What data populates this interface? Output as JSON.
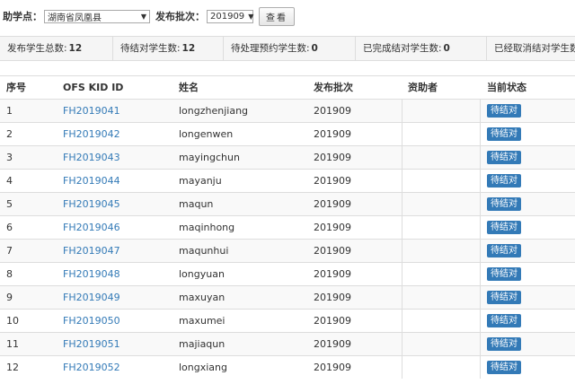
{
  "filters": {
    "county_label": "助学点：",
    "county_value": "湖南省凤凰县",
    "batch_label": "发布批次：",
    "batch_value": "201909",
    "view_button": "查看"
  },
  "stats": {
    "total_label": "发布学生总数:",
    "total_value": "12",
    "waiting_label": "待结对学生数:",
    "waiting_value": "12",
    "pending_label": "待处理预约学生数:",
    "pending_value": "0",
    "done_label": "已完成结对学生数:",
    "done_value": "0",
    "cancel_label": "已经取消结对学生数"
  },
  "table": {
    "headers": {
      "idx": "序号",
      "kid": "OFS KID ID",
      "name": "姓名",
      "batch": "发布批次",
      "sponsor": "资助者",
      "status": "当前状态"
    },
    "rows": [
      {
        "idx": "1",
        "kid": "FH2019041",
        "name": "longzhenjiang",
        "batch": "201909",
        "sponsor": "",
        "status": "待结对"
      },
      {
        "idx": "2",
        "kid": "FH2019042",
        "name": "longenwen",
        "batch": "201909",
        "sponsor": "",
        "status": "待结对"
      },
      {
        "idx": "3",
        "kid": "FH2019043",
        "name": "mayingchun",
        "batch": "201909",
        "sponsor": "",
        "status": "待结对"
      },
      {
        "idx": "4",
        "kid": "FH2019044",
        "name": "mayanju",
        "batch": "201909",
        "sponsor": "",
        "status": "待结对"
      },
      {
        "idx": "5",
        "kid": "FH2019045",
        "name": "maqun",
        "batch": "201909",
        "sponsor": "",
        "status": "待结对"
      },
      {
        "idx": "6",
        "kid": "FH2019046",
        "name": "maqinhong",
        "batch": "201909",
        "sponsor": "",
        "status": "待结对"
      },
      {
        "idx": "7",
        "kid": "FH2019047",
        "name": "maqunhui",
        "batch": "201909",
        "sponsor": "",
        "status": "待结对"
      },
      {
        "idx": "8",
        "kid": "FH2019048",
        "name": "longyuan",
        "batch": "201909",
        "sponsor": "",
        "status": "待结对"
      },
      {
        "idx": "9",
        "kid": "FH2019049",
        "name": "maxuyan",
        "batch": "201909",
        "sponsor": "",
        "status": "待结对"
      },
      {
        "idx": "10",
        "kid": "FH2019050",
        "name": "maxumei",
        "batch": "201909",
        "sponsor": "",
        "status": "待结对"
      },
      {
        "idx": "11",
        "kid": "FH2019051",
        "name": "majiaqun",
        "batch": "201909",
        "sponsor": "",
        "status": "待结对"
      },
      {
        "idx": "12",
        "kid": "FH2019052",
        "name": "longxiang",
        "batch": "201909",
        "sponsor": "",
        "status": "待结对"
      }
    ]
  }
}
